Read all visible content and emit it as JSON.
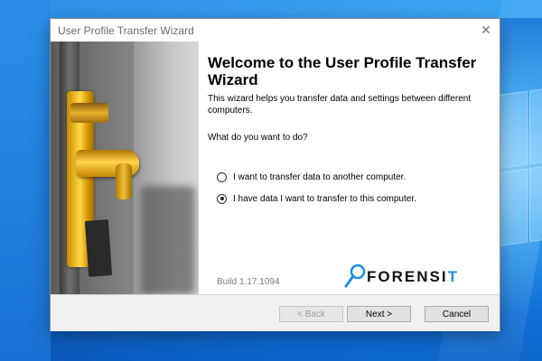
{
  "window": {
    "title": "User Profile Transfer Wizard",
    "close_glyph": "✕"
  },
  "wizard": {
    "heading": "Welcome to the User Profile Transfer Wizard",
    "description": "This wizard helps you transfer data and settings between different computers.",
    "question": "What do you want to do?",
    "options": [
      {
        "label": "I want to transfer data to another computer.",
        "selected": false
      },
      {
        "label": "I have data I want to transfer to this computer.",
        "selected": true
      }
    ],
    "build": "Build 1.17.1094",
    "logo": {
      "text_main": "FORENSI",
      "text_accent": "T",
      "icon": "magnifier-icon"
    }
  },
  "buttons": {
    "back": "< Back",
    "next": "Next >",
    "cancel": "Cancel"
  },
  "colors": {
    "accent": "#1a8ee0",
    "desktop": "#0f6fd6"
  }
}
